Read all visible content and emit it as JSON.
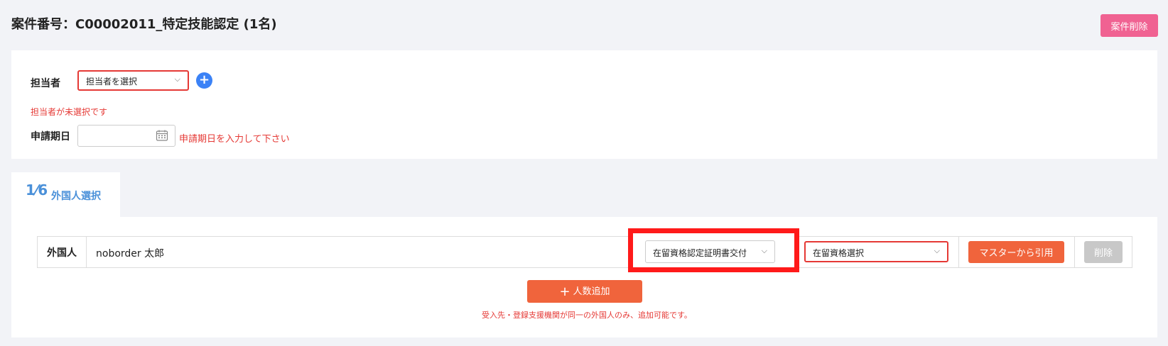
{
  "header": {
    "title": "案件番号：C00002011_特定技能認定 (1名)",
    "delete_case_label": "案件削除"
  },
  "form": {
    "assignee_label": "担当者",
    "assignee_select_value": "担当者を選択",
    "add_assignee_icon": "plus-circle-icon",
    "assignee_error": "担当者が未選択です",
    "date_label": "申請期日",
    "date_value": "",
    "calendar_icon": "calendar-icon",
    "date_error": "申請期日を入力して下さい"
  },
  "step": {
    "glyph": "1⁄6",
    "label": "外国人選択"
  },
  "foreigner_row": {
    "label": "外国人",
    "name": "noborder 太郎",
    "status_select_value": "在留資格認定証明書交付",
    "visa_select_value": "在留資格選択",
    "master_button_label": "マスターから引用",
    "delete_button_label": "削除"
  },
  "add_person_label": "人数追加",
  "note": "受入先・登録支援機関が同一の外国人のみ、追加可能です。",
  "colors": {
    "accent_pink": "#f06292",
    "accent_orange": "#f0643c",
    "error_red": "#e53935",
    "link_blue": "#4a90d9",
    "highlight_red": "#ff1a1a"
  }
}
